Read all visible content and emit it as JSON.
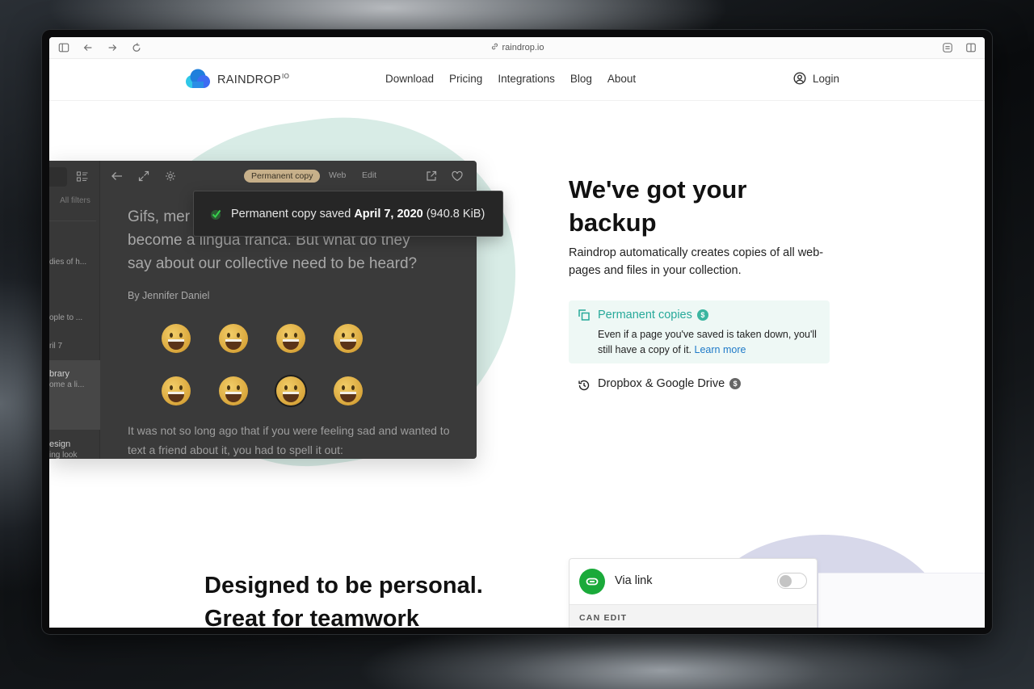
{
  "browser": {
    "url": "raindrop.io",
    "buttons": [
      "sidebar-toggle",
      "back",
      "forward",
      "reload",
      "reader",
      "split-view"
    ]
  },
  "site": {
    "logo": {
      "name": "RAINDROP",
      "suffix": "IO"
    },
    "nav": [
      "Download",
      "Pricing",
      "Integrations",
      "Blog",
      "About"
    ],
    "login": "Login"
  },
  "app": {
    "sidebar": {
      "filters": "All filters",
      "items": [
        {
          "text": "dies of h..."
        },
        {
          "text": "ople to ..."
        },
        {
          "text": "ril 7"
        },
        {
          "title": "brary",
          "text": "ome a li..."
        },
        {
          "title": "esign",
          "text": "ing look"
        }
      ]
    },
    "toolbar": {
      "tabs": [
        "Permanent copy",
        "Web",
        "Edit"
      ],
      "active_tab": "Permanent copy"
    },
    "article": {
      "lead": "Gifs, memes, and emoji have become a lingua franca. But what do they say about our collective need to be heard?",
      "lead_visible_start": "Gifs, mer",
      "lead_line2": "become a lingua franca. But what do they",
      "lead_line3": "say about our collective need to be heard?",
      "byline": "By Jennifer Daniel",
      "emoji_count": 8,
      "body": "It was not so long ago that if you were feeling sad and wanted to text a friend about it, you had to spell it out:"
    },
    "toast": {
      "prefix": "Permanent copy saved",
      "date": "April 7, 2020",
      "size": "(940.8 KiB)"
    }
  },
  "backup": {
    "title": "We've got your backup",
    "description": "Raindrop automatically creates copies of all web-pages and files in your collection.",
    "features": [
      {
        "title": "Permanent copies",
        "paid_badge": "$",
        "description": "Even if a page you've saved is taken down, you'll still have a copy of it.",
        "link": "Learn more",
        "active": true,
        "color": "#27a99a"
      },
      {
        "title": "Dropbox & Google Drive",
        "paid_badge": "$",
        "active": false
      }
    ]
  },
  "personal": {
    "title_line1": "Designed to be personal.",
    "title_line2": "Great for teamwork",
    "share": {
      "label": "Via link",
      "toggle_on": false,
      "section": "CAN EDIT"
    }
  }
}
